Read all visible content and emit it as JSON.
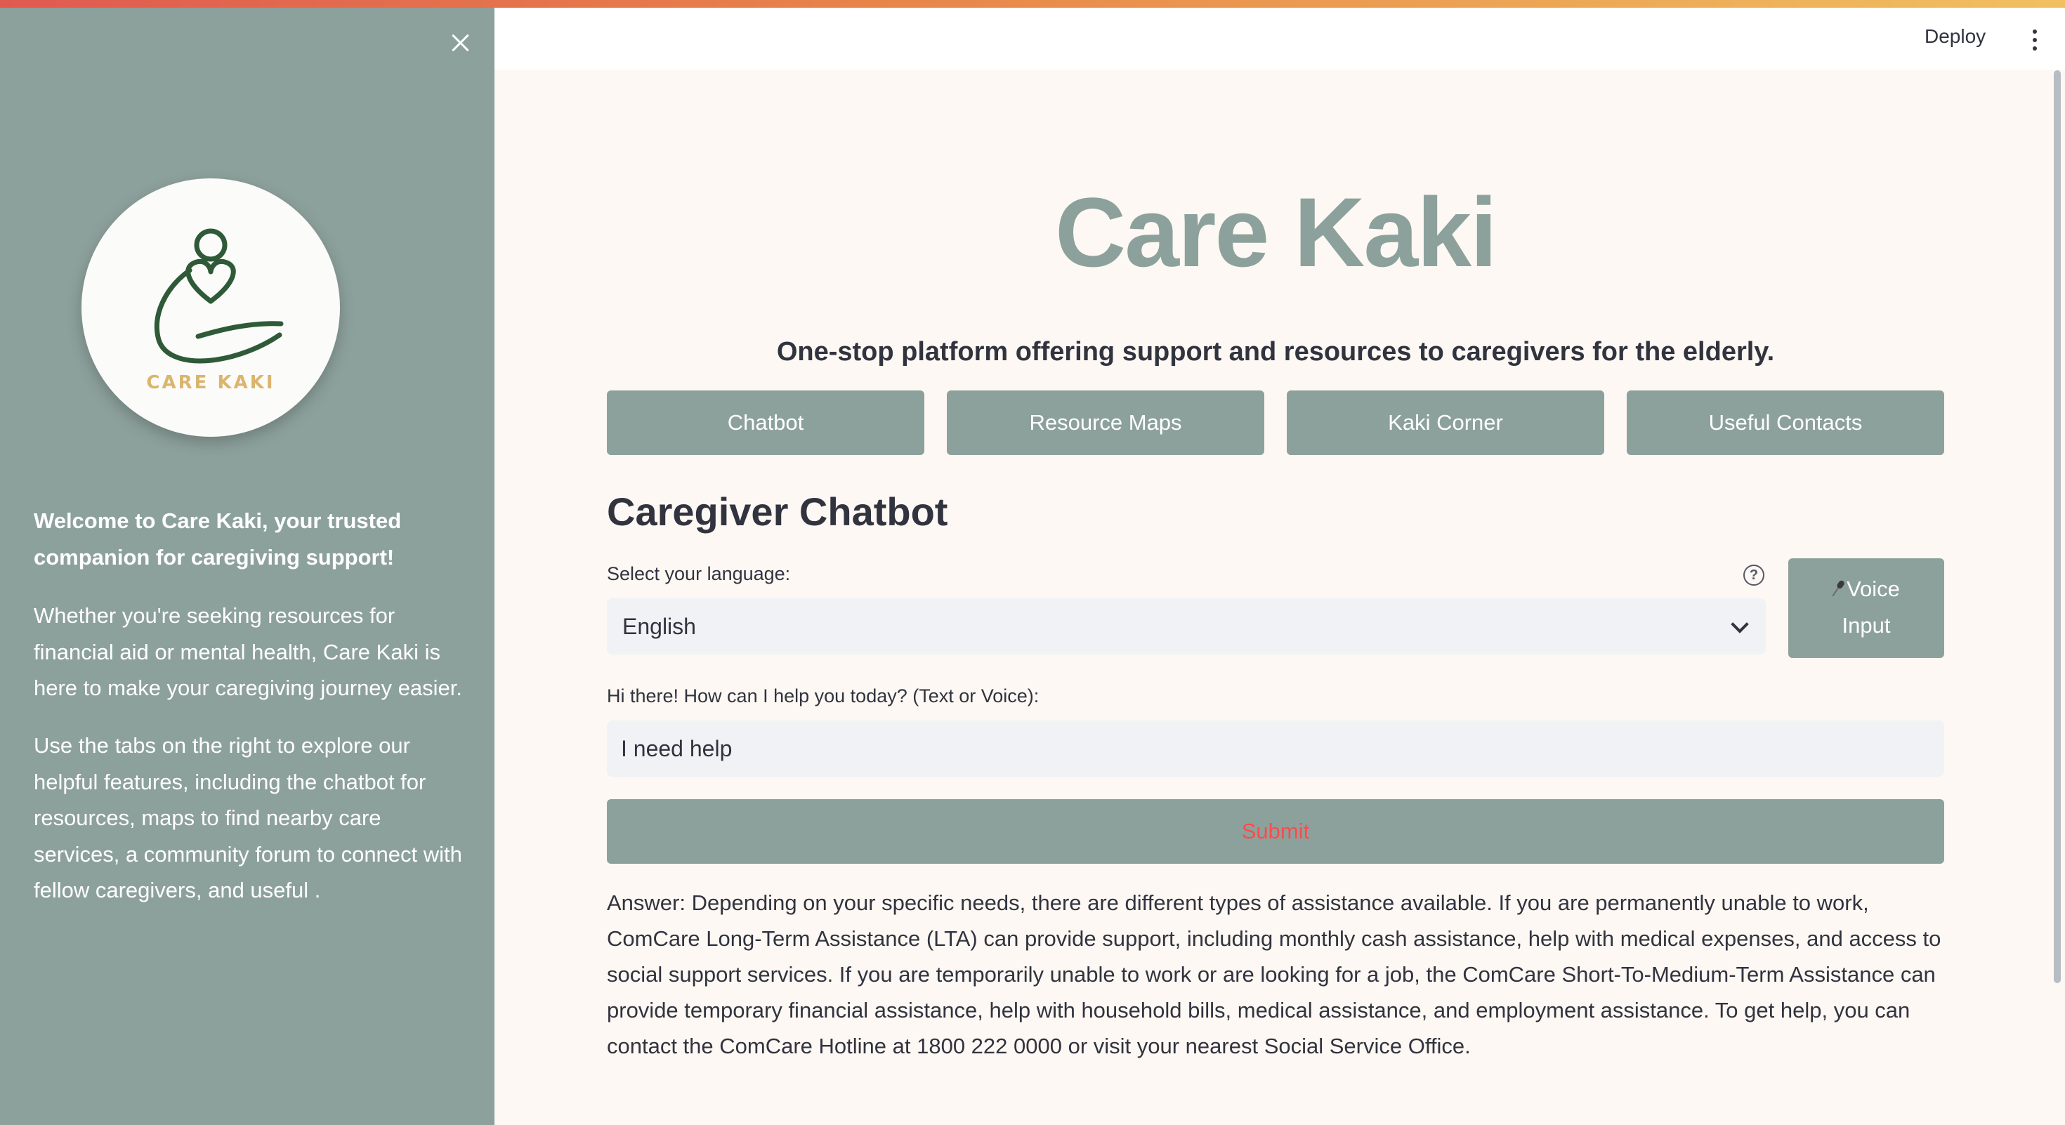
{
  "sidebar": {
    "logo_text": "CARE KAKI",
    "welcome": "Welcome to Care Kaki, your trusted companion for caregiving support!",
    "paragraph1": "Whether you're seeking resources for financial aid or mental health, Care Kaki is here to make your caregiving journey easier.",
    "paragraph2": "Use the tabs on the right to explore our helpful features, including the chatbot for resources, maps to find nearby care services, a community forum to connect with fellow caregivers, and useful ."
  },
  "header": {
    "deploy_label": "Deploy"
  },
  "main": {
    "title": "Care Kaki",
    "subtitle": "One-stop platform offering support and resources to caregivers for the elderly.",
    "tabs": [
      {
        "label": "Chatbot"
      },
      {
        "label": "Resource Maps"
      },
      {
        "label": "Kaki Corner"
      },
      {
        "label": "Useful Contacts"
      }
    ],
    "chatbot": {
      "heading": "Caregiver Chatbot",
      "language_label": "Select your language:",
      "language_value": "English",
      "voice_label_line1": "Voice",
      "voice_label_line2": "Input",
      "prompt_label": "Hi there! How can I help you today? (Text or Voice):",
      "input_value": "I need help",
      "submit_label": "Submit",
      "answer": "Answer: Depending on your specific needs, there are different types of assistance available. If you are permanently unable to work, ComCare Long-Term Assistance (LTA) can provide support, including monthly cash assistance, help with medical expenses, and access to social support services. If you are temporarily unable to work or are looking for a job, the ComCare Short-To-Medium-Term Assistance can provide temporary financial assistance, help with household bills, medical assistance, and employment assistance. To get help, you can contact the ComCare Hotline at 1800 222 0000 or visit your nearest Social Service Office."
    }
  },
  "colors": {
    "sidebar_bg": "#8da19c",
    "accent": "#8da19c",
    "page_bg": "#fdf8f3",
    "submit_text": "#ff4b4b",
    "logo_text": "#dbb56d"
  },
  "icons": [
    "close-icon",
    "caregiver-hand-heart-logo",
    "help-circle-icon",
    "chevron-down-icon",
    "microphone-icon",
    "kebab-menu-icon"
  ]
}
